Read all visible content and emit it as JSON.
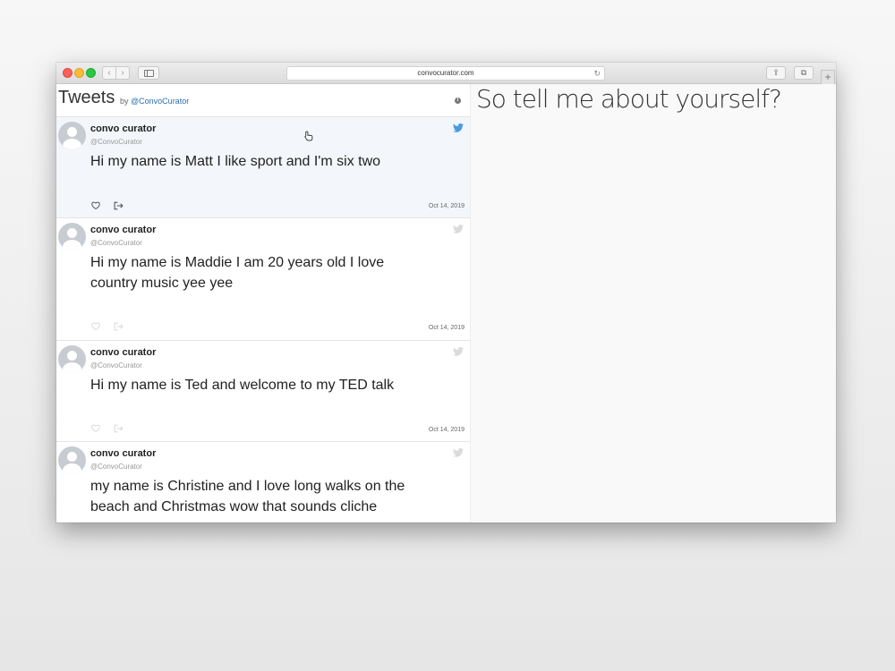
{
  "browser": {
    "url": "convocurator.com",
    "back_glyph": "‹",
    "forward_glyph": "›",
    "reload_glyph": "↻",
    "share_glyph": "⇪",
    "tabs_glyph": "⧉",
    "newtab_glyph": "+"
  },
  "feed": {
    "title": "Tweets",
    "by_prefix": "by",
    "by_handle": "@ConvoCurator",
    "info_glyph": "i"
  },
  "tweets": [
    {
      "author": "convo curator",
      "handle": "@ConvoCurator",
      "text": "Hi my name is Matt I like sport and I'm six two",
      "date": "Oct 14, 2019"
    },
    {
      "author": "convo curator",
      "handle": "@ConvoCurator",
      "text": "Hi my name is Maddie I am 20 years old I love country music yee yee",
      "date": "Oct 14, 2019"
    },
    {
      "author": "convo curator",
      "handle": "@ConvoCurator",
      "text": "Hi my name is Ted and welcome to my TED talk",
      "date": "Oct 14, 2019"
    },
    {
      "author": "convo curator",
      "handle": "@ConvoCurator",
      "text": "my name is Christine and I love long walks on the beach and Christmas wow that sounds cliche"
    }
  ],
  "prompt": {
    "text": "So tell me about yourself?"
  },
  "colors": {
    "twitter_blue": "#4a9be0",
    "link_blue": "#2a6fb0",
    "highlight_bg": "#f3f6fa"
  }
}
